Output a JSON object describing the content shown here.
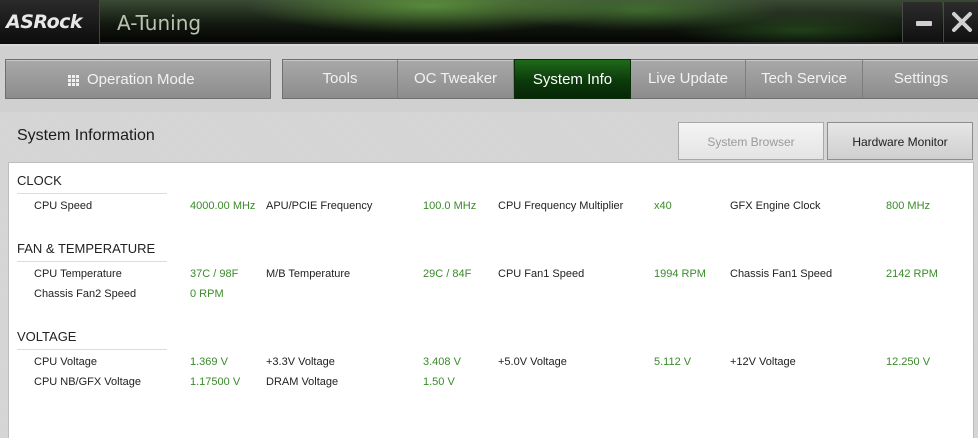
{
  "window": {
    "brand": "ASRock",
    "title": "A-Tuning",
    "minimize_icon": "minimize-icon",
    "close_icon": "close-icon"
  },
  "nav": {
    "operation_mode": "Operation Mode",
    "operation_mode_icon": "grid-icon",
    "tabs": [
      {
        "label": "Tools"
      },
      {
        "label": "OC Tweaker"
      },
      {
        "label": "System Info",
        "active": true
      },
      {
        "label": "Live Update"
      },
      {
        "label": "Tech Service"
      },
      {
        "label": "Settings"
      }
    ]
  },
  "page": {
    "title": "System Information",
    "system_browser": "System Browser",
    "hardware_monitor": "Hardware Monitor"
  },
  "clock": {
    "heading": "CLOCK",
    "cpu_speed_label": "CPU Speed",
    "cpu_speed_value": "4000.00 MHz",
    "apu_pcie_label": "APU/PCIE Frequency",
    "apu_pcie_value": "100.0 MHz",
    "cpu_mult_label": "CPU Frequency Multiplier",
    "cpu_mult_value": "x40",
    "gfx_clock_label": "GFX Engine Clock",
    "gfx_clock_value": "800 MHz"
  },
  "fan_temp": {
    "heading": "FAN & TEMPERATURE",
    "cpu_temp_label": "CPU Temperature",
    "cpu_temp_value": "37C / 98F",
    "mb_temp_label": "M/B Temperature",
    "mb_temp_value": "29C / 84F",
    "cpu_fan1_label": "CPU Fan1 Speed",
    "cpu_fan1_value": "1994 RPM",
    "chassis_fan1_label": "Chassis Fan1 Speed",
    "chassis_fan1_value": "2142 RPM",
    "chassis_fan2_label": "Chassis Fan2 Speed",
    "chassis_fan2_value": "0 RPM"
  },
  "voltage": {
    "heading": "VOLTAGE",
    "cpu_v_label": "CPU Voltage",
    "cpu_v_value": "1.369 V",
    "v33_label": "+3.3V Voltage",
    "v33_value": "3.408 V",
    "v50_label": "+5.0V Voltage",
    "v50_value": "5.112 V",
    "v12_label": "+12V Voltage",
    "v12_value": "12.250 V",
    "nb_gfx_label": "CPU NB/GFX Voltage",
    "nb_gfx_value": "1.17500 V",
    "dram_label": "DRAM Voltage",
    "dram_value": "1.50 V"
  },
  "colors": {
    "value_green": "#3a8a2a",
    "active_tab": "#1f6a1a"
  }
}
